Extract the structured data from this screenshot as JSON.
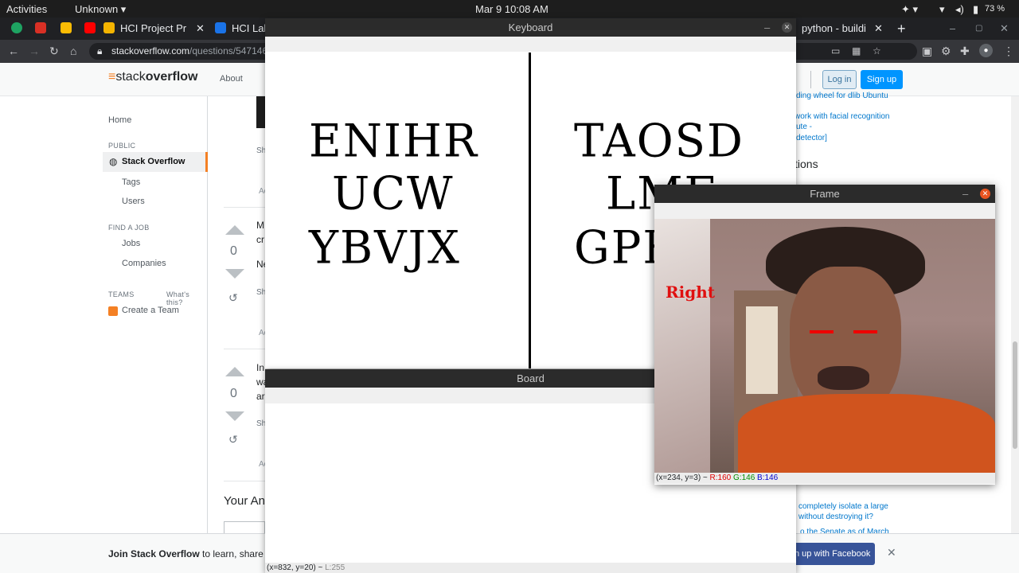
{
  "system_bar": {
    "activities": "Activities",
    "unknown": "Unknown ▾",
    "datetime": "Mar 9  10:08 AM",
    "battery": "73 %"
  },
  "browser": {
    "tabs": [
      {
        "label": "HCI Project Pr",
        "close": "✕"
      },
      {
        "label": "HCI Lal"
      },
      {
        "label": "python - buildi",
        "close": "✕"
      }
    ],
    "new_tab": "+",
    "url_domain": "stackoverflow.com",
    "url_path": "/questions/5471460"
  },
  "so": {
    "about": "About",
    "login": "Log in",
    "signup": "Sign up",
    "nav": {
      "home": "Home",
      "public": "PUBLIC",
      "stack_overflow": "Stack Overflow",
      "tags": "Tags",
      "users": "Users",
      "find_job": "FIND A JOB",
      "jobs": "Jobs",
      "companies": "Companies",
      "teams": "TEAMS",
      "whats_this": "What's this?",
      "create_team": "Create a Team"
    },
    "votes": [
      "0",
      "0"
    ],
    "snippets": [
      "M",
      "cr",
      "Ne",
      "Sh",
      "In",
      "wa",
      "ar",
      "Sh",
      "Sh",
      "Ac",
      "Ac",
      "Ac"
    ],
    "your_answer": "Your Ans",
    "side_links": [
      "ding wheel for dlib Ubuntu",
      "work with facial recognition",
      "ute -",
      "detector]",
      "tions",
      "completely isolate a large",
      "without destroying it?",
      "o the Senate as of March"
    ],
    "banner_bold": "Join Stack Overflow",
    "banner_rest": " to learn, share",
    "fb": "n up with Facebook",
    "banner_close": "✕"
  },
  "keyboard": {
    "title": "Keyboard",
    "left_rows": [
      "ENIHR",
      "UCW",
      "YBVJX"
    ],
    "right_rows": [
      "TAOSD",
      "LMF",
      "GPK"
    ]
  },
  "board": {
    "title": "Board",
    "status": "(x=832, y=20) ~ ",
    "status_l": "L:255"
  },
  "frame": {
    "title": "Frame",
    "direction": "Right",
    "status": "(x=234, y=3) ~ ",
    "r": "R:160",
    "g": "G:146",
    "b": "B:146",
    "colors": {
      "r": "#e00000",
      "g": "#009000",
      "b": "#0000d0"
    }
  }
}
